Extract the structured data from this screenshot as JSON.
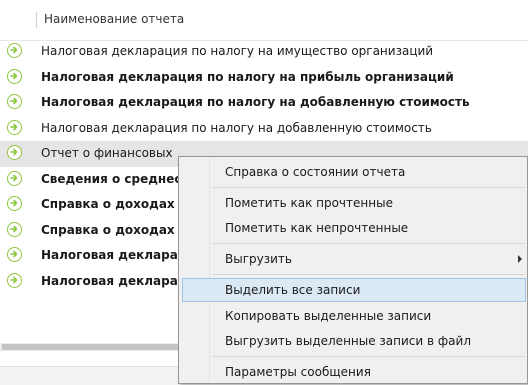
{
  "header": {
    "column_title": "Наименование отчета"
  },
  "rows": [
    {
      "label": "Налоговая декларация по налогу на имущество организаций"
    },
    {
      "label": "Налоговая декларация по налогу на прибыль организаций"
    },
    {
      "label": "Налоговая декларация по налогу на добавленную стоимость"
    },
    {
      "label": "Налоговая декларация по налогу на добавленную стоимость"
    },
    {
      "label": "Отчет о финансовых"
    },
    {
      "label": "Сведения о среднес"
    },
    {
      "label": "Справка о доходах и"
    },
    {
      "label": "Справка о доходах и"
    },
    {
      "label": "Налоговая деклара"
    },
    {
      "label": "Налоговая деклара"
    }
  ],
  "context_menu": {
    "report_status": "Справка о состоянии отчета",
    "mark_read": "Пометить как прочтенные",
    "mark_unread": "Пометить как непрочтенные",
    "export": "Выгрузить",
    "select_all": "Выделить все записи",
    "copy_selected": "Копировать выделенные записи",
    "export_selected_to_file": "Выгрузить выделенные записи в файл",
    "message_params": "Параметры сообщения"
  },
  "colors": {
    "icon": "#8cc63f",
    "highlight": "#dbe9f4",
    "highlight_border": "#9fc4e4"
  }
}
